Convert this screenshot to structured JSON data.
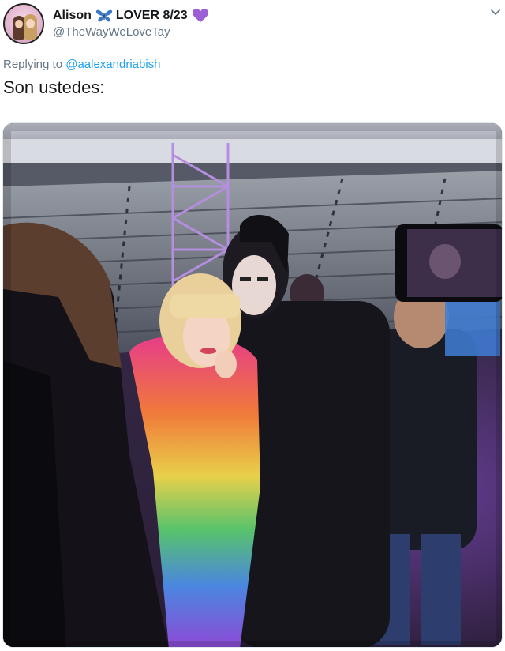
{
  "tweet": {
    "display_name": "Alison",
    "display_name_suffix": "LOVER 8/23",
    "handle": "@TheWayWeLoveTay",
    "replying_prefix": "Replying to",
    "replying_mention": "@aalexandriabish",
    "text": "Son ustedes:"
  },
  "icons": {
    "butterfly": "butterfly-icon",
    "heart": "purple-heart-icon",
    "menu": "chevron-down-icon"
  },
  "colors": {
    "text": "#14171a",
    "secondary": "#657786",
    "link": "#1da1f2",
    "butterfly": "#3a79c9",
    "heart": "#9c5fd6"
  }
}
